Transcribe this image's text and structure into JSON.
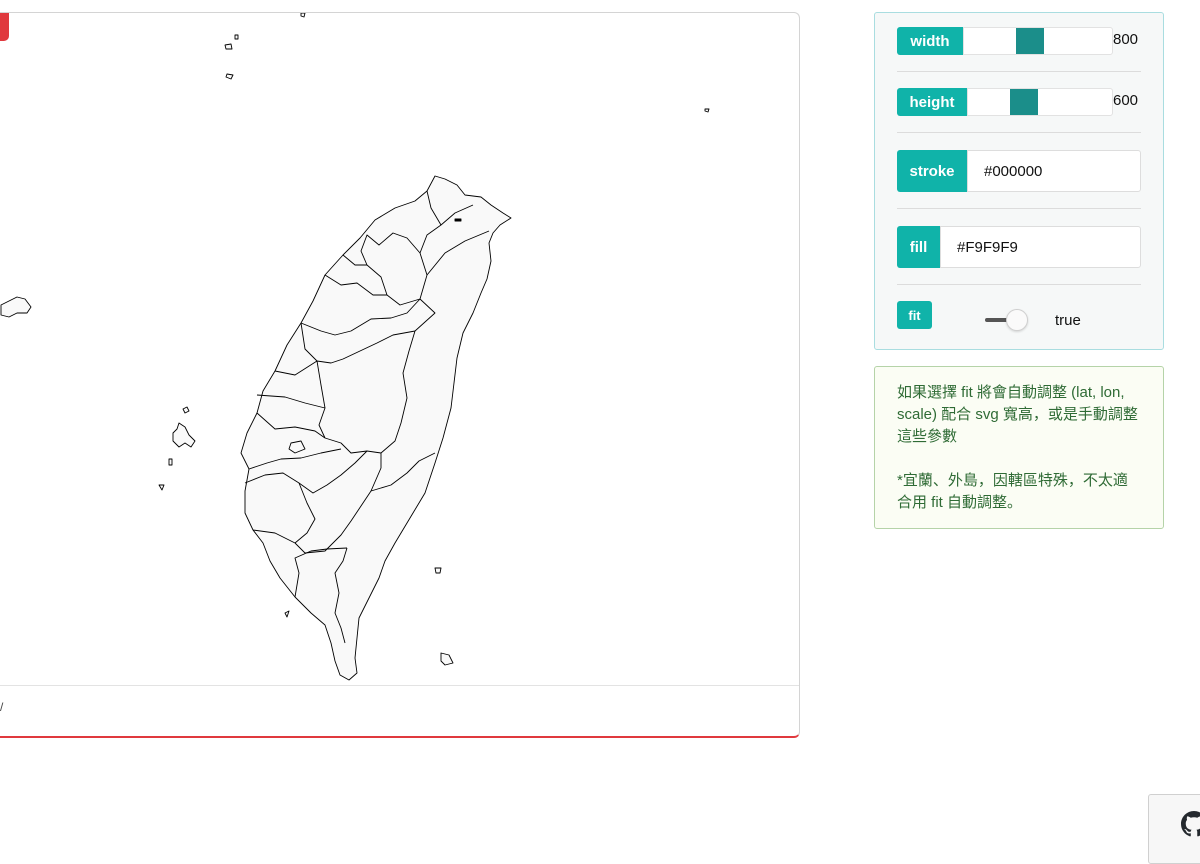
{
  "map": {
    "footer_mark": "/"
  },
  "controls": {
    "width": {
      "label": "width",
      "value": "800"
    },
    "height": {
      "label": "height",
      "value": "600"
    },
    "stroke": {
      "label": "stroke",
      "value": "#000000"
    },
    "fill": {
      "label": "fill",
      "value": "#F9F9F9"
    },
    "fit": {
      "label": "fit",
      "value": "true"
    }
  },
  "info": {
    "line1": "如果選擇 fit 將會自動調整 (lat, lon, scale) 配合 svg 寬高，或是手動調整這些參數",
    "line2": "*宜蘭、外島，因轄區特殊，不太適合用 fit 自動調整。"
  },
  "icons": {
    "github": "github-icon"
  },
  "colors": {
    "accent": "#10b3a9",
    "slider_thumb": "#1b8e8a",
    "map_stroke": "#000000",
    "map_fill": "#F9F9F9",
    "card_accent": "#e0393e"
  }
}
